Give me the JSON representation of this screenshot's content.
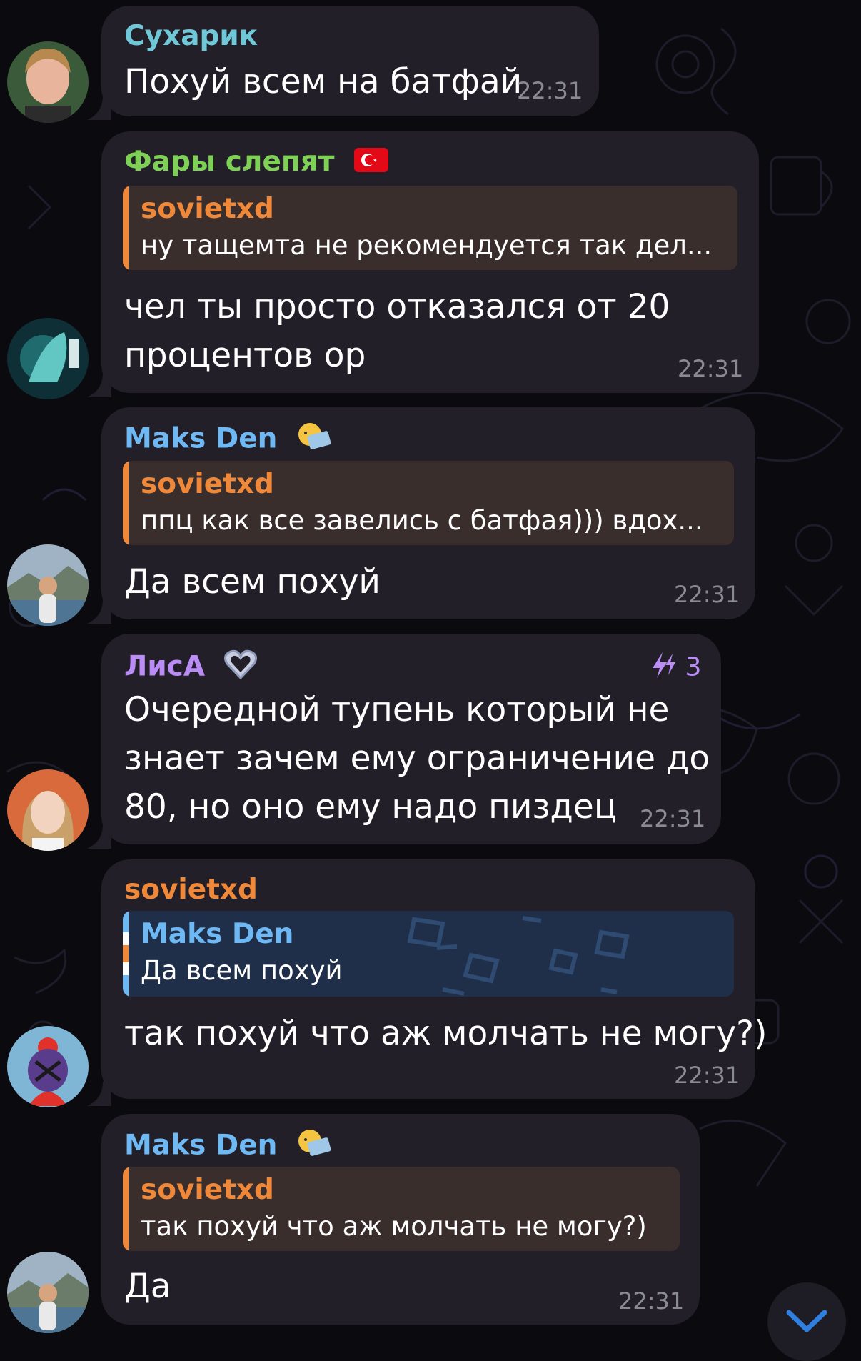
{
  "messages": [
    {
      "sender": "Сухарик",
      "text_lines": [
        "Похуй всем на батфай"
      ],
      "time": "22:31"
    },
    {
      "sender": "Фары слепят",
      "reply": {
        "name": "sovietxd",
        "text": "ну тащемта не рекомендуется так дел..."
      },
      "text_lines": [
        "чел ты просто отказался от 20",
        "процентов ор"
      ],
      "time": "22:31"
    },
    {
      "sender": "Maks Den",
      "reply": {
        "name": "sovietxd",
        "text": "ппц как все завелись с батфая))) вдох..."
      },
      "text_lines": [
        "Да всем похуй"
      ],
      "time": "22:31"
    },
    {
      "sender": "ЛисА",
      "boost_count": "3",
      "text_lines": [
        "Очередной тупень который не",
        "знает зачем ему ограничение до",
        "80, но оно ему надо пиздец"
      ],
      "time": "22:31"
    },
    {
      "sender": "sovietxd",
      "reply": {
        "name": "Maks Den",
        "text": "Да всем похуй"
      },
      "text_lines": [
        "так похуй что аж молчать не могу?)"
      ],
      "time": "22:31"
    },
    {
      "sender": "Maks Den",
      "reply": {
        "name": "sovietxd",
        "text": "так похуй что аж молчать не могу?)"
      },
      "text_lines": [
        "Да"
      ],
      "time": "22:31"
    }
  ],
  "colors": {
    "background": "#0b0b0f",
    "bubble": "#221f28",
    "orange": "#f0883a",
    "green": "#7ed156",
    "blue": "#6eb8f4",
    "purple": "#b98cf6",
    "time": "#8a8a92"
  },
  "icons": {
    "turkey_flag": "flag-turkey-icon",
    "maks_emoji": "laptop-emoji-icon",
    "lisa_heart": "heart-icon",
    "boost": "boost-icon",
    "scroll_down": "chevron-down-icon"
  }
}
